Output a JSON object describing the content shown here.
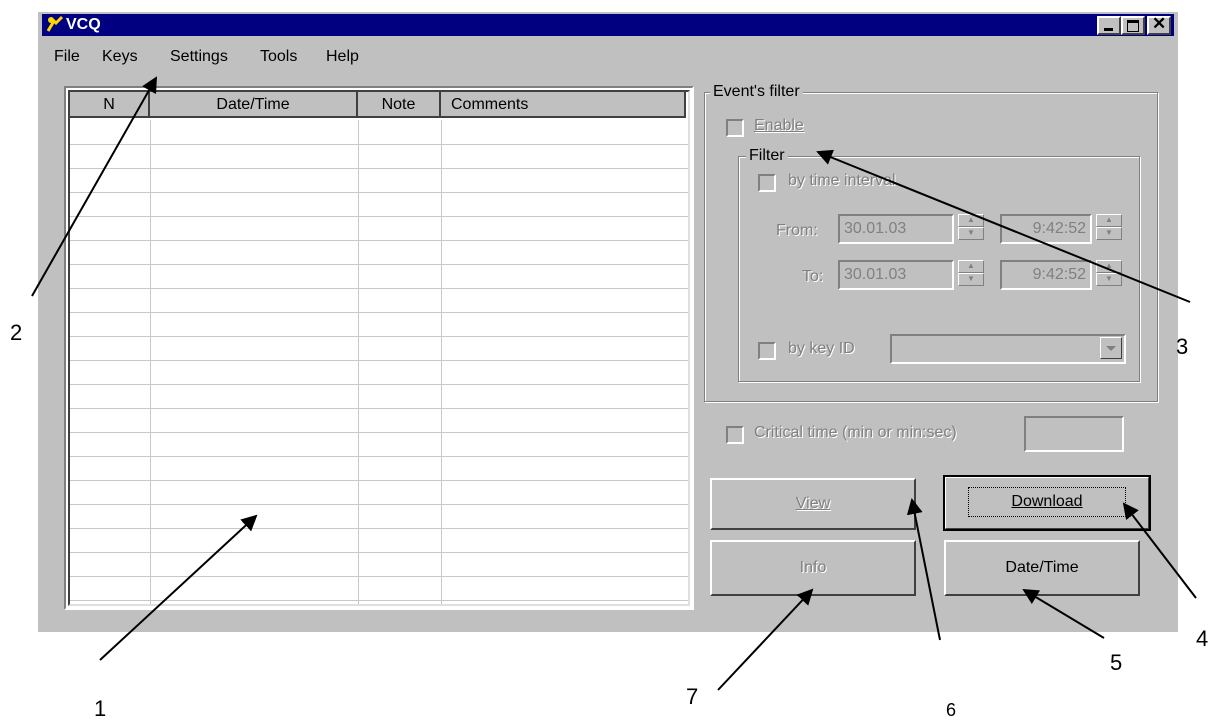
{
  "window": {
    "title": "VCQ"
  },
  "menu": [
    "File",
    "Keys",
    "Settings",
    "Tools",
    "Help"
  ],
  "table": {
    "columns": [
      "N",
      "Date/Time",
      "Note",
      "Comments"
    ],
    "rows": []
  },
  "filter_panel": {
    "group_label": "Event's filter",
    "enable_label": "Enable",
    "filter_group_label": "Filter",
    "by_time_interval_label": "by time interval",
    "from_label": "From:",
    "from_date": "30.01.03",
    "from_time": "9:42:52",
    "to_label": "To:",
    "to_date": "30.01.03",
    "to_time": "9:42:52",
    "by_key_id_label": "by key ID",
    "key_id_value": ""
  },
  "critical_time": {
    "label": "Critical time (min or min:sec)",
    "value": ""
  },
  "buttons": {
    "view": "View",
    "download": "Download",
    "info": "Info",
    "datetime": "Date/Time"
  },
  "callouts": [
    "1",
    "2",
    "3",
    "4",
    "5",
    "6",
    "7"
  ]
}
